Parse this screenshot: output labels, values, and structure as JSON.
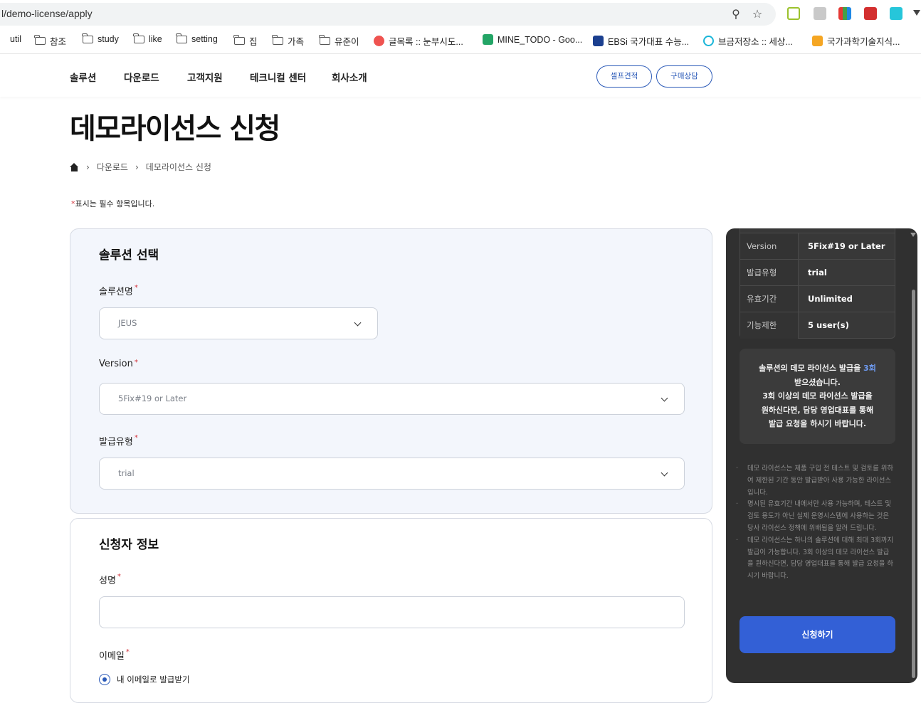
{
  "browser": {
    "url": "l/demo-license/apply",
    "bookmarks": [
      "util",
      "참조",
      "study",
      "like",
      "setting",
      "집",
      "가족",
      "유준이",
      "글목록 :: 눈부시도...",
      "MINE_TODO - Goo...",
      "EBSi 국가대표 수능...",
      "브금저장소 :: 세상...",
      "국가과학기술지식..."
    ],
    "icons": [
      "zoom-icon",
      "star-icon",
      "extensions"
    ]
  },
  "nav": {
    "items": [
      "솔루션",
      "다운로드",
      "고객지원",
      "테크니컬 센터",
      "회사소개"
    ],
    "quote_button": "셀프견적",
    "consult_button": "구매상담"
  },
  "page": {
    "title": "데모라이선스 신청",
    "breadcrumb": [
      "다운로드",
      "데모라이선스 신청"
    ],
    "required_mark": "*",
    "required_note": "표시는 필수 항목입니다."
  },
  "solution_section": {
    "title": "솔루션 선택",
    "fields": [
      {
        "label": "솔루션명",
        "value": "JEUS"
      },
      {
        "label": "Version",
        "value": "5Fix#19 or Later"
      },
      {
        "label": "발급유형",
        "value": "trial"
      }
    ]
  },
  "applicant_section": {
    "title": "신청자 정보",
    "name_label": "성명",
    "name_value": "",
    "email_label": "이메일",
    "email_option": "내 이메일로 발급받기"
  },
  "summary": {
    "rows": [
      {
        "key": "Version",
        "value": "5Fix#19 or Later"
      },
      {
        "key": "발급유형",
        "value": "trial"
      },
      {
        "key": "유효기간",
        "value": "Unlimited"
      },
      {
        "key": "기능제한",
        "value": "5 user(s)"
      }
    ],
    "notice_pre": "솔루션의 데모 라이선스 발급을 ",
    "notice_count": "3회",
    "notice_line2": "받으셨습니다.",
    "notice_line3": "3회 이상의 데모 라이선스 발급을",
    "notice_line4": "원하신다면, 담당 영업대표를 통해",
    "notice_line5": "발급 요청을 하시기 바랍니다.",
    "notes": [
      "데모 라이선스는 제품 구입 전 테스트 및 검토를 위하여 제한된 기간 동안 발급받아 사용 가능한 라이선스 입니다.",
      "명시된 유효기간 내에서만 사용 가능하며, 테스트 및 검토 용도가 아닌 실제 운영시스템에 사용하는 것은 당사 라이선스 정책에 위배됨을 알려 드립니다.",
      "데모 라이선스는 하나의 솔루션에 대해 최대 3회까지 발급이 가능합니다. 3회 이상의 데모 라이선스 발급을 원하신다면, 담당 영업대표를 통해 발급 요청을 하시기 바랍니다."
    ],
    "apply_button": "신청하기"
  },
  "colors": {
    "accent": "#3360d6",
    "panel_bg": "#303030",
    "card_bg": "#f3f6fc",
    "required": "#d3333b"
  }
}
